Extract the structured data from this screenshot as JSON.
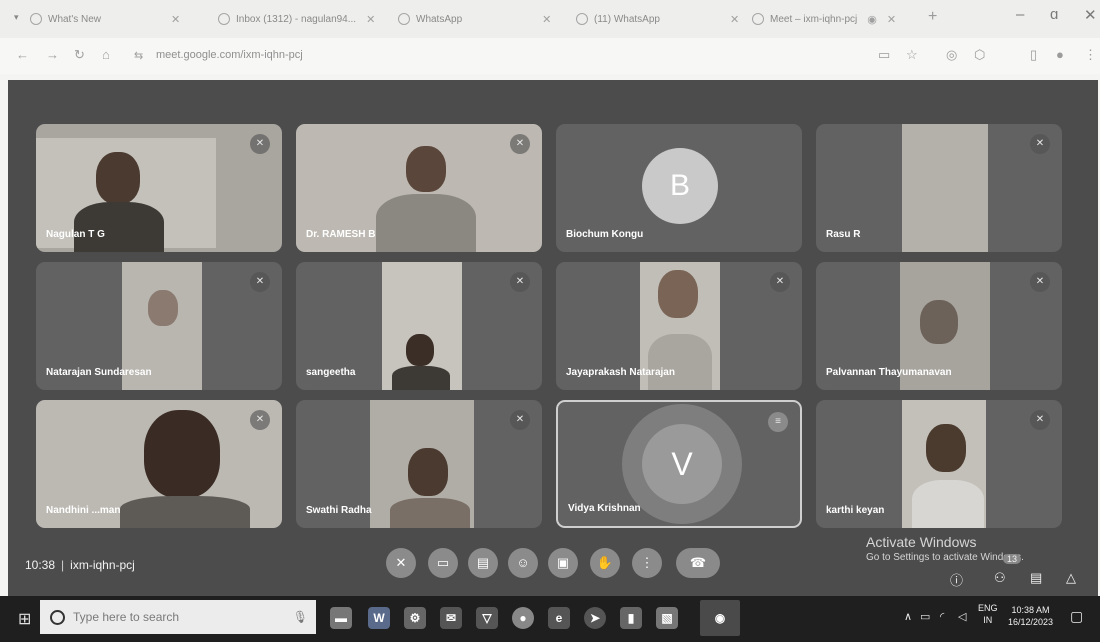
{
  "browser": {
    "tabs": [
      {
        "label": "What's New"
      },
      {
        "label": "Inbox (1312) - nagulan94..."
      },
      {
        "label": "WhatsApp"
      },
      {
        "label": "(11) WhatsApp"
      },
      {
        "label": "Meet – ixm-iqhn-pcj"
      }
    ],
    "url": "meet.google.com/ixm-iqhn-pcj"
  },
  "meet": {
    "time": "10:38",
    "separator": "|",
    "meeting_code": "ixm-iqhn-pcj",
    "participants": [
      {
        "name": "Nagulan T G",
        "type": "video"
      },
      {
        "name": "Dr. RAMESH B",
        "type": "video"
      },
      {
        "name": "Biochum Kongu",
        "type": "avatar",
        "initial": "B",
        "avatar_color": "#c9c9c9"
      },
      {
        "name": "Rasu R",
        "type": "video"
      },
      {
        "name": "Natarajan Sundaresan",
        "type": "video"
      },
      {
        "name": "sangeetha",
        "type": "video"
      },
      {
        "name": "Jayaprakash Natarajan",
        "type": "video"
      },
      {
        "name": "Palvannan Thayumanavan",
        "type": "video"
      },
      {
        "name": "Nandhini ...man",
        "type": "video"
      },
      {
        "name": "Swathi Radha",
        "type": "video"
      },
      {
        "name": "Vidya Krishnan",
        "type": "avatar",
        "initial": "V",
        "avatar_color": "#9a9a9a",
        "speaking": true
      },
      {
        "name": "karthi keyan",
        "type": "video"
      }
    ],
    "watermark": {
      "title": "Activate Windows",
      "subtitle": "Go to Settings to activate Windows."
    },
    "side_badge": "13"
  },
  "taskbar": {
    "search_placeholder": "Type here to search",
    "lang_line1": "ENG",
    "lang_line2": "IN",
    "time": "10:38 AM",
    "date": "16/12/2023"
  },
  "colors": {
    "stage": "#4c4c4c",
    "tile": "#626262",
    "end_call": "#8a8a8a"
  }
}
